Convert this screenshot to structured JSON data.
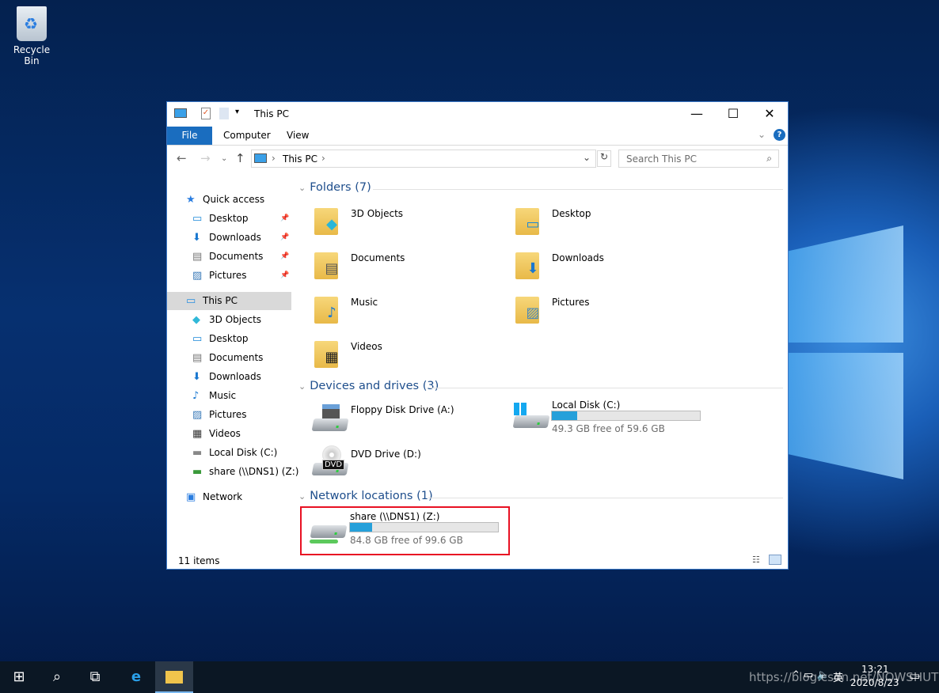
{
  "desktop": {
    "recycle_bin": "Recycle Bin"
  },
  "window": {
    "title": "This PC",
    "minimize": "—",
    "maximize": "☐",
    "close": "✕",
    "tabs": [
      "File",
      "Computer",
      "View"
    ],
    "address": {
      "path": "This PC",
      "separator": "›"
    },
    "search_placeholder": "Search This PC",
    "status": "11 items"
  },
  "nav": [
    {
      "label": "Quick access",
      "icon": "star-icon",
      "level": 0,
      "pinned": false
    },
    {
      "label": "Desktop",
      "icon": "desktop-icon",
      "level": 1,
      "pinned": true
    },
    {
      "label": "Downloads",
      "icon": "downloads-icon",
      "level": 1,
      "pinned": true
    },
    {
      "label": "Documents",
      "icon": "documents-icon",
      "level": 1,
      "pinned": true
    },
    {
      "label": "Pictures",
      "icon": "pictures-icon",
      "level": 1,
      "pinned": true
    },
    {
      "label": "This PC",
      "icon": "computer-icon",
      "level": 0,
      "selected": true,
      "gap": true
    },
    {
      "label": "3D Objects",
      "icon": "3d-objects-icon",
      "level": 1
    },
    {
      "label": "Desktop",
      "icon": "desktop-icon",
      "level": 1
    },
    {
      "label": "Documents",
      "icon": "documents-icon",
      "level": 1
    },
    {
      "label": "Downloads",
      "icon": "downloads-icon",
      "level": 1
    },
    {
      "label": "Music",
      "icon": "music-icon",
      "level": 1
    },
    {
      "label": "Pictures",
      "icon": "pictures-icon",
      "level": 1
    },
    {
      "label": "Videos",
      "icon": "videos-icon",
      "level": 1
    },
    {
      "label": "Local Disk (C:)",
      "icon": "drive-icon",
      "level": 1
    },
    {
      "label": "share (\\\\DNS1) (Z:)",
      "icon": "network-drive-icon",
      "level": 1
    },
    {
      "label": "Network",
      "icon": "network-icon",
      "level": 0,
      "gap": true
    }
  ],
  "sections": {
    "folders": "Folders (7)",
    "devices": "Devices and drives (3)",
    "network": "Network locations (1)"
  },
  "folders": [
    {
      "name": "3D Objects",
      "icon": "3d-objects-icon"
    },
    {
      "name": "Desktop",
      "icon": "desktop-icon"
    },
    {
      "name": "Documents",
      "icon": "documents-icon"
    },
    {
      "name": "Downloads",
      "icon": "downloads-icon"
    },
    {
      "name": "Music",
      "icon": "music-icon"
    },
    {
      "name": "Pictures",
      "icon": "pictures-icon"
    },
    {
      "name": "Videos",
      "icon": "videos-icon"
    }
  ],
  "drives": [
    {
      "name": "Floppy Disk Drive (A:)",
      "icon": "floppy-drive-icon"
    },
    {
      "name": "Local Disk (C:)",
      "icon": "windows-drive-icon",
      "free": "49.3 GB free of 59.6 GB",
      "used_percent": 17.3
    },
    {
      "name": "DVD Drive (D:)",
      "icon": "dvd-drive-icon",
      "badge": "DVD"
    }
  ],
  "network_drive": {
    "name": "share (\\\\DNS1) (Z:)",
    "free": "84.8 GB free of 99.6 GB",
    "used_percent": 14.9,
    "highlight_color": "#e81123"
  },
  "taskbar": {
    "time": "13:21",
    "date": "2020/8/23",
    "ime": "英",
    "watermark": "https://blog.csdn.net/NOWSHUT"
  },
  "colors": {
    "accent": "#1a6dbf",
    "section_header": "#1e4e8c",
    "bar_fill": "#26a0da"
  }
}
